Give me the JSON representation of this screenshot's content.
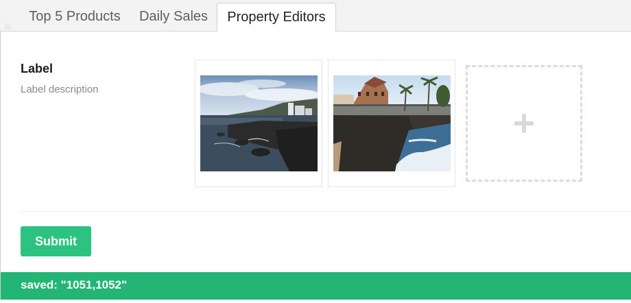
{
  "tabs": [
    {
      "label": "Top 5 Products",
      "active": false
    },
    {
      "label": "Daily Sales",
      "active": false
    },
    {
      "label": "Property Editors",
      "active": true
    }
  ],
  "editor": {
    "label": "Label",
    "description": "Label description"
  },
  "media": {
    "items": [
      {
        "name": "photo-coast-town"
      },
      {
        "name": "photo-coast-building"
      }
    ],
    "add_icon": "plus-icon"
  },
  "form": {
    "submit_label": "Submit"
  },
  "status": {
    "text": "saved: \"1051,1052\""
  },
  "colors": {
    "accent": "#2bc37f",
    "status_bar": "#22b573"
  }
}
